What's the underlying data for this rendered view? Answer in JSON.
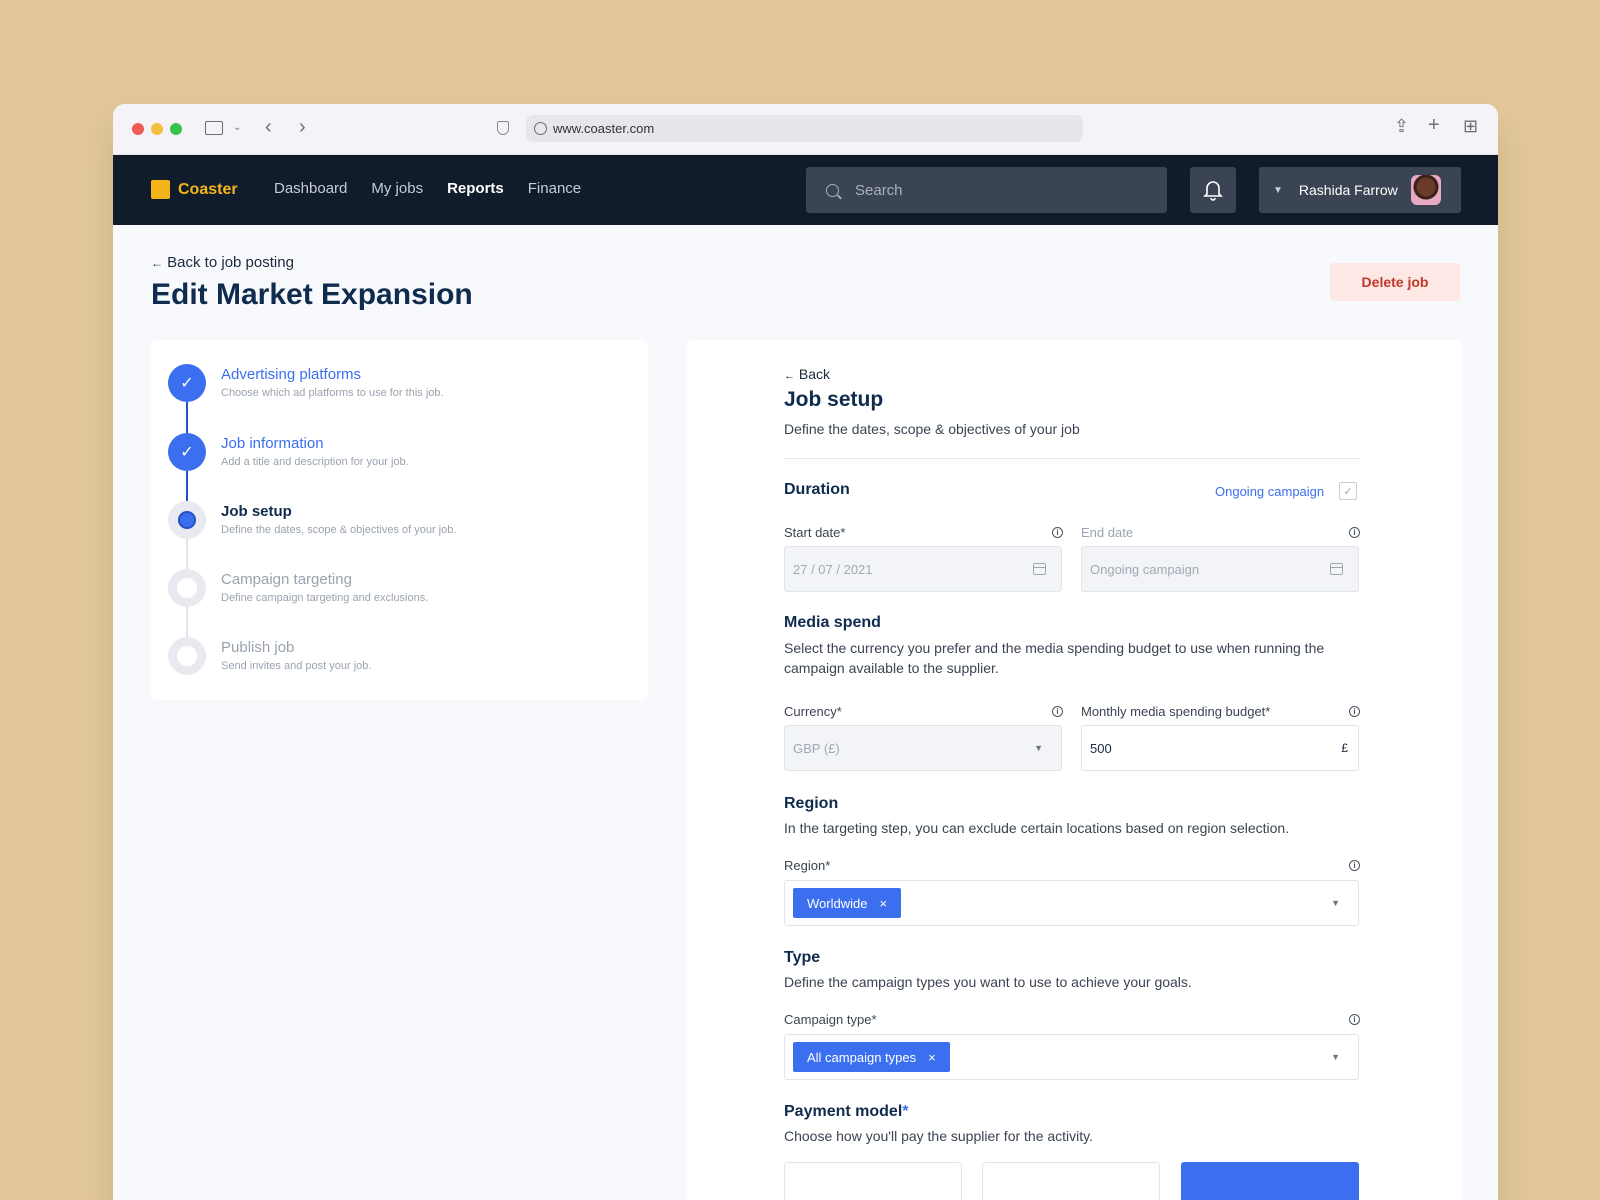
{
  "browser": {
    "url": "www.coaster.com"
  },
  "nav": {
    "brand": "Coaster",
    "links": [
      "Dashboard",
      "My jobs",
      "Reports",
      "Finance"
    ],
    "active": "Reports",
    "search_placeholder": "Search",
    "user_name": "Rashida Farrow"
  },
  "page": {
    "back_label": "Back to job posting",
    "title": "Edit Market Expansion",
    "delete_label": "Delete job"
  },
  "steps": [
    {
      "title": "Advertising platforms",
      "desc": "Choose which ad platforms to use for this job.",
      "state": "done"
    },
    {
      "title": "Job information",
      "desc": "Add a title and description for your job.",
      "state": "done"
    },
    {
      "title": "Job setup",
      "desc": "Define the dates, scope & objectives of your job.",
      "state": "current"
    },
    {
      "title": "Campaign targeting",
      "desc": "Define campaign targeting and exclusions.",
      "state": "todo"
    },
    {
      "title": "Publish job",
      "desc": "Send invites and post your job.",
      "state": "todo"
    }
  ],
  "form": {
    "back_label": "Back",
    "title": "Job setup",
    "subtitle": "Define the dates, scope & objectives of your job",
    "duration": {
      "heading": "Duration",
      "ongoing_label": "Ongoing campaign",
      "ongoing_checked": true,
      "start_label": "Start date*",
      "start_value": "27 / 07 / 2021",
      "end_label": "End date",
      "end_placeholder": "Ongoing campaign"
    },
    "media": {
      "heading": "Media spend",
      "desc": "Select the currency you prefer and the media spending budget to use when running the campaign available to the supplier.",
      "currency_label": "Currency*",
      "currency_value": "GBP (£)",
      "budget_label": "Monthly media spending budget*",
      "budget_value": "500",
      "budget_unit": "£"
    },
    "region": {
      "heading": "Region",
      "desc": "In the targeting step, you can exclude certain locations based on region selection.",
      "label": "Region*",
      "tag": "Worldwide"
    },
    "type": {
      "heading": "Type",
      "desc": "Define the campaign types you want to use to achieve your goals.",
      "label": "Campaign type*",
      "tag": "All campaign types"
    },
    "payment": {
      "heading": "Payment model",
      "required_mark": "*",
      "desc": "Choose how you'll pay the supplier for the activity."
    }
  },
  "colors": {
    "accent": "#3b6ff0",
    "nav_bg": "#101c2b",
    "brand": "#f5b51a",
    "danger": "#c0392b"
  }
}
